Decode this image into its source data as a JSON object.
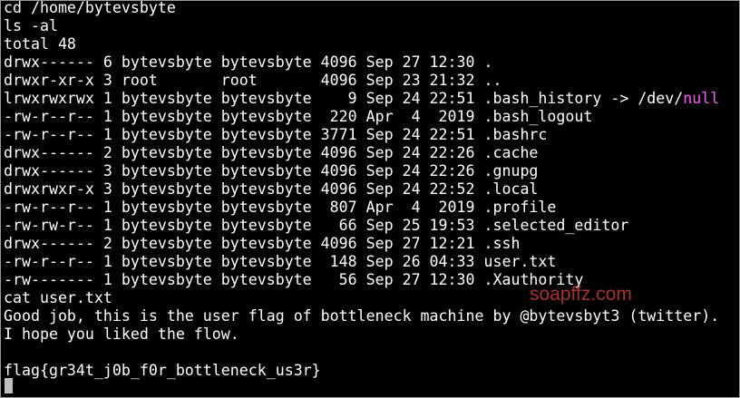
{
  "terminal": {
    "commands": {
      "cd": "cd /home/bytevsbyte",
      "ls": "ls -al",
      "cat": "cat user.txt"
    },
    "total": "total 48",
    "listing": [
      "drwx------ 6 bytevsbyte bytevsbyte 4096 Sep 27 12:30 .",
      "drwxr-xr-x 3 root       root       4096 Sep 23 21:32 ..",
      "-rw-r--r-- 1 bytevsbyte bytevsbyte  220 Apr  4  2019 .bash_logout",
      "-rw-r--r-- 1 bytevsbyte bytevsbyte 3771 Sep 24 22:51 .bashrc",
      "drwx------ 2 bytevsbyte bytevsbyte 4096 Sep 24 22:26 .cache",
      "drwx------ 3 bytevsbyte bytevsbyte 4096 Sep 24 22:26 .gnupg",
      "drwxrwxr-x 3 bytevsbyte bytevsbyte 4096 Sep 24 22:52 .local",
      "-rw-r--r-- 1 bytevsbyte bytevsbyte  807 Apr  4  2019 .profile",
      "-rw-rw-r-- 1 bytevsbyte bytevsbyte   66 Sep 25 19:53 .selected_editor",
      "drwx------ 2 bytevsbyte bytevsbyte 4096 Sep 27 12:21 .ssh",
      "-rw-r--r-- 1 bytevsbyte bytevsbyte  148 Sep 26 04:33 user.txt",
      "-rw------- 1 bytevsbyte bytevsbyte   56 Sep 27 12:30 .Xauthority"
    ],
    "symlink": {
      "prefix": "lrwxrwxrwx 1 bytevsbyte bytevsbyte    9 Sep 24 22:51 .bash_history -> /dev/",
      "target": "null"
    },
    "output": {
      "line1": "Good job, this is the user flag of bottleneck machine by @bytevsbyt3 (twitter).",
      "line2": "I hope you liked the flow.",
      "flag": "flag{gr34t_j0b_f0r_bottleneck_us3r}"
    },
    "watermark": "soapffz.com",
    "colors": {
      "background": "#000000",
      "text": "#ffffff",
      "symlink_target": "#ff55ff",
      "watermark": "#c83a3a",
      "cursor": "#c0c0c0"
    }
  }
}
